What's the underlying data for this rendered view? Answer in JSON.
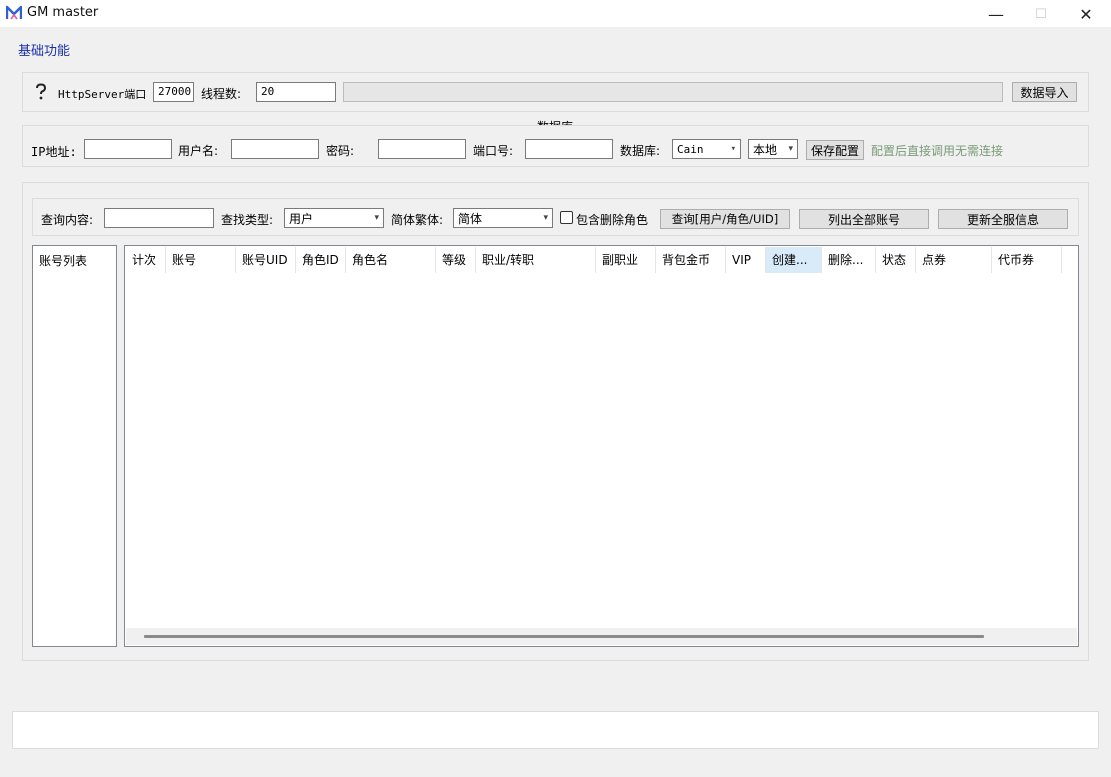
{
  "window": {
    "title": "GM master",
    "minimize": "—",
    "maximize": "☐",
    "close": "✕"
  },
  "menu": {
    "basic": "基础功能"
  },
  "server": {
    "port_label": "HttpServer端口",
    "port_value": "27000",
    "threads_label": "线程数:",
    "threads_value": "20",
    "import_button": "数据导入",
    "progress": 0
  },
  "database": {
    "group_title": "数据库",
    "ip_label": "IP地址:",
    "ip_value": "",
    "user_label": "用户名:",
    "user_value": "",
    "password_label": "密码:",
    "password_value": "",
    "port_label": "端口号:",
    "port_value": "",
    "db_label": "数据库:",
    "db_selected": "Cain",
    "location_selected": "本地",
    "save_button": "保存配置",
    "hint": "配置后直接调用无需连接"
  },
  "query": {
    "content_label": "查询内容:",
    "content_value": "",
    "type_label": "查找类型:",
    "type_selected": "用户",
    "script_label": "简体繁体:",
    "script_selected": "简体",
    "include_deleted_label": "包含删除角色",
    "include_deleted_checked": false,
    "query_button": "查询[用户/角色/UID]",
    "list_all_button": "列出全部账号",
    "update_all_button": "更新全服信息"
  },
  "accounts": {
    "header": "账号列表"
  },
  "grid": {
    "columns": [
      "计次",
      "账号",
      "账号UID",
      "角色ID",
      "角色名",
      "等级",
      "职业/转职",
      "副职业",
      "背包金币",
      "VIP",
      "创建...",
      "删除...",
      "状态",
      "点券",
      "代币券"
    ],
    "selected_column": "创建...",
    "rows": []
  },
  "colors": {
    "menu_link": "#1a2fa8",
    "hint_text": "#7a9a78",
    "selected_header": "#d9ebf9"
  },
  "icons": {
    "app": "app-logo-icon",
    "help": "question-icon",
    "dropdown": "chevron-down-icon"
  }
}
